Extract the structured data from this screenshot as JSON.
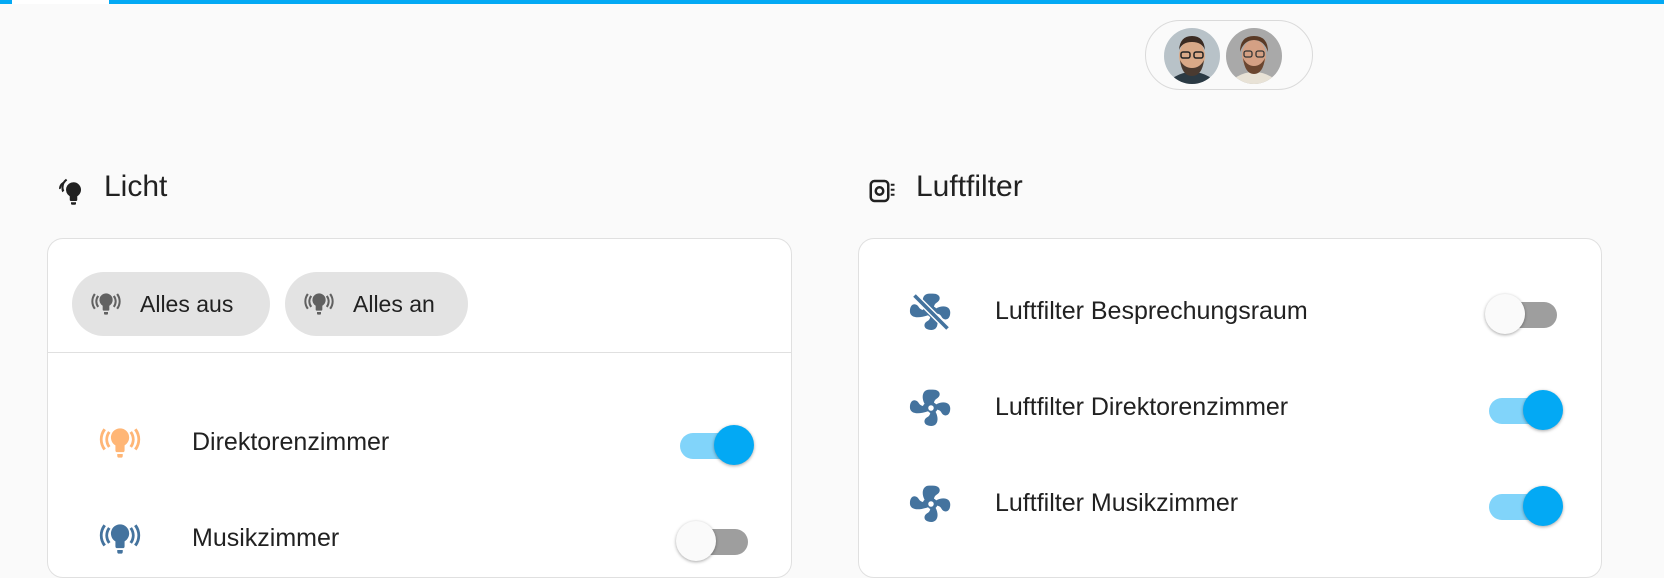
{
  "colors": {
    "accent": "#03a9f4",
    "icon_blue": "#44739e",
    "icon_light_on": "#ffb676",
    "chip_bg": "#e3e3e3"
  },
  "header": {
    "avatars": [
      {
        "name": "avatar-person-1"
      },
      {
        "name": "avatar-person-2"
      }
    ]
  },
  "licht": {
    "title": "Licht",
    "icon": "lightbulb-group-icon",
    "actions": [
      {
        "label": "Alles aus",
        "icon": "lightbulb-group-icon"
      },
      {
        "label": "Alles an",
        "icon": "lightbulb-group-icon"
      }
    ],
    "entities": [
      {
        "label": "Direktorenzimmer",
        "icon": "lightbulb-group-icon",
        "state": "on"
      },
      {
        "label": "Musikzimmer",
        "icon": "lightbulb-group-icon",
        "state": "off"
      }
    ]
  },
  "luftfilter": {
    "title": "Luftfilter",
    "icon": "air-purifier-icon",
    "entities": [
      {
        "label": "Luftfilter Besprechungsraum",
        "icon": "fan-off-icon",
        "state": "off"
      },
      {
        "label": "Luftfilter Direktorenzimmer",
        "icon": "fan-icon",
        "state": "on"
      },
      {
        "label": "Luftfilter Musikzimmer",
        "icon": "fan-icon",
        "state": "on"
      }
    ]
  }
}
